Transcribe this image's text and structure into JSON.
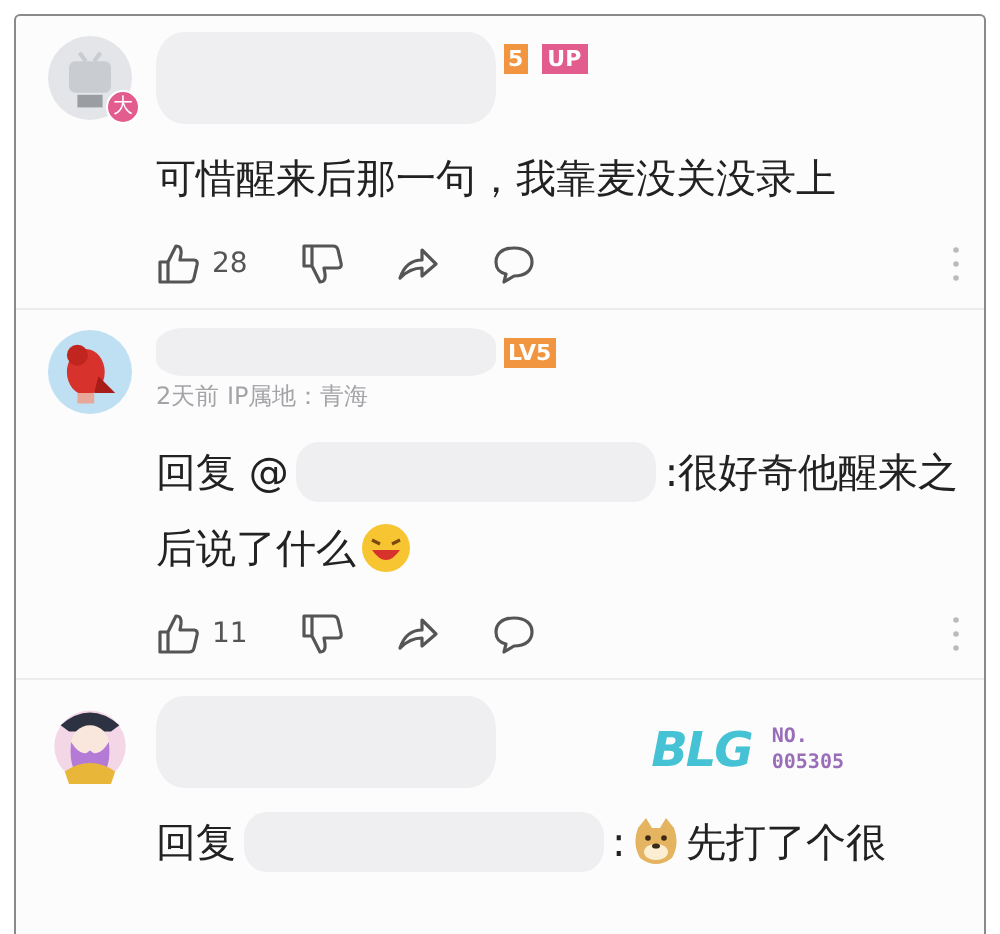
{
  "comments": [
    {
      "avatar": {
        "kind": "tv"
      },
      "vip_badge": "大",
      "level_badge": "5",
      "up_badge": "UP",
      "lines": [
        [
          {
            "kind": "text",
            "text": "可惜醒来后那一句，我靠麦没关没录上"
          }
        ]
      ],
      "likes": "28",
      "more_menu": true
    },
    {
      "avatar": {
        "kind": "bird"
      },
      "level_badge": "LV5",
      "meta": "2天前  IP属地：青海",
      "lines": [
        [
          {
            "kind": "text",
            "text": "回复 @"
          },
          {
            "kind": "blur"
          },
          {
            "kind": "text",
            "text": ":很好奇他醒来之"
          }
        ],
        [
          {
            "kind": "text",
            "text": "后说了什么"
          },
          {
            "kind": "grin-emoji"
          }
        ]
      ],
      "likes": "11",
      "more_menu": true
    },
    {
      "avatar": {
        "kind": "character"
      },
      "medal": {
        "logo": "BLG",
        "label": "NO.",
        "number": "005305"
      },
      "lines": [
        [
          {
            "kind": "text",
            "text": "回复"
          },
          {
            "kind": "blur"
          },
          {
            "kind": "text",
            "text": ":"
          },
          {
            "kind": "doge-emoji"
          },
          {
            "kind": "text",
            "text": "先打了个很"
          }
        ]
      ],
      "more_menu": false
    }
  ]
}
